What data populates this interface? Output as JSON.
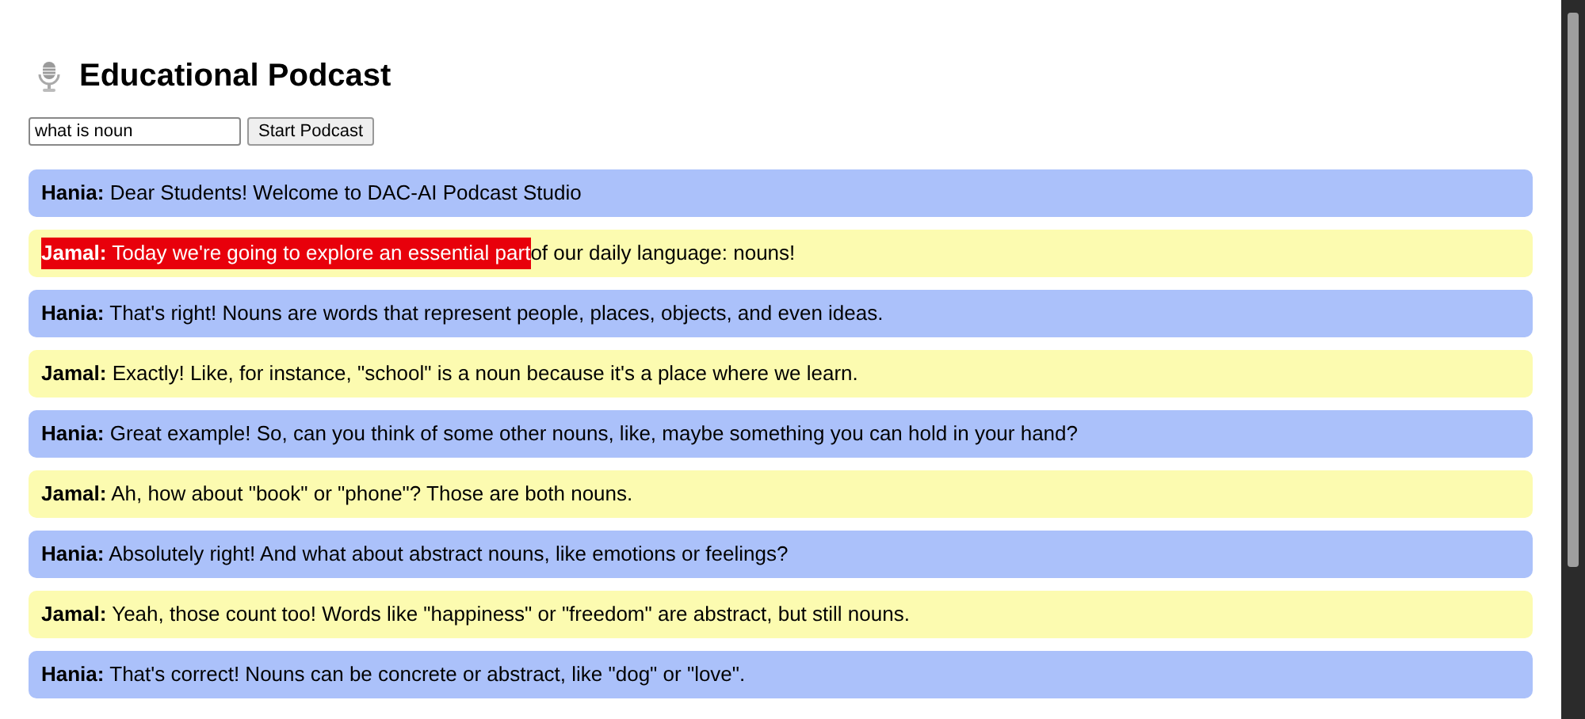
{
  "title": "Educational Podcast",
  "topic_field": {
    "value": "what is noun"
  },
  "start_button": "Start Podcast",
  "messages": [
    {
      "speaker": "Hania:",
      "color": "#abc1fa",
      "text": "Dear Students! Welcome to DAC-AI Podcast Studio"
    },
    {
      "speaker": "Jamal:",
      "color": "#fcfbb0",
      "highlighted_text": "Today we're going to explore an essential part ",
      "text": "of our daily language: nouns!"
    },
    {
      "speaker": "Hania:",
      "color": "#abc1fa",
      "text": "That's right! Nouns are words that represent people, places, objects, and even ideas."
    },
    {
      "speaker": "Jamal:",
      "color": "#fcfbb0",
      "text": "Exactly! Like, for instance, \"school\" is a noun because it's a place where we learn."
    },
    {
      "speaker": "Hania:",
      "color": "#abc1fa",
      "text": "Great example! So, can you think of some other nouns, like, maybe something you can hold in your hand?"
    },
    {
      "speaker": "Jamal:",
      "color": "#fcfbb0",
      "text": "Ah, how about \"book\" or \"phone\"? Those are both nouns."
    },
    {
      "speaker": "Hania:",
      "color": "#abc1fa",
      "text": "Absolutely right! And what about abstract nouns, like emotions or feelings?"
    },
    {
      "speaker": "Jamal:",
      "color": "#fcfbb0",
      "text": "Yeah, those count too! Words like \"happiness\" or \"freedom\" are abstract, but still nouns."
    },
    {
      "speaker": "Hania:",
      "color": "#abc1fa",
      "text": "That's correct! Nouns can be concrete or abstract, like \"dog\" or \"love\"."
    }
  ]
}
